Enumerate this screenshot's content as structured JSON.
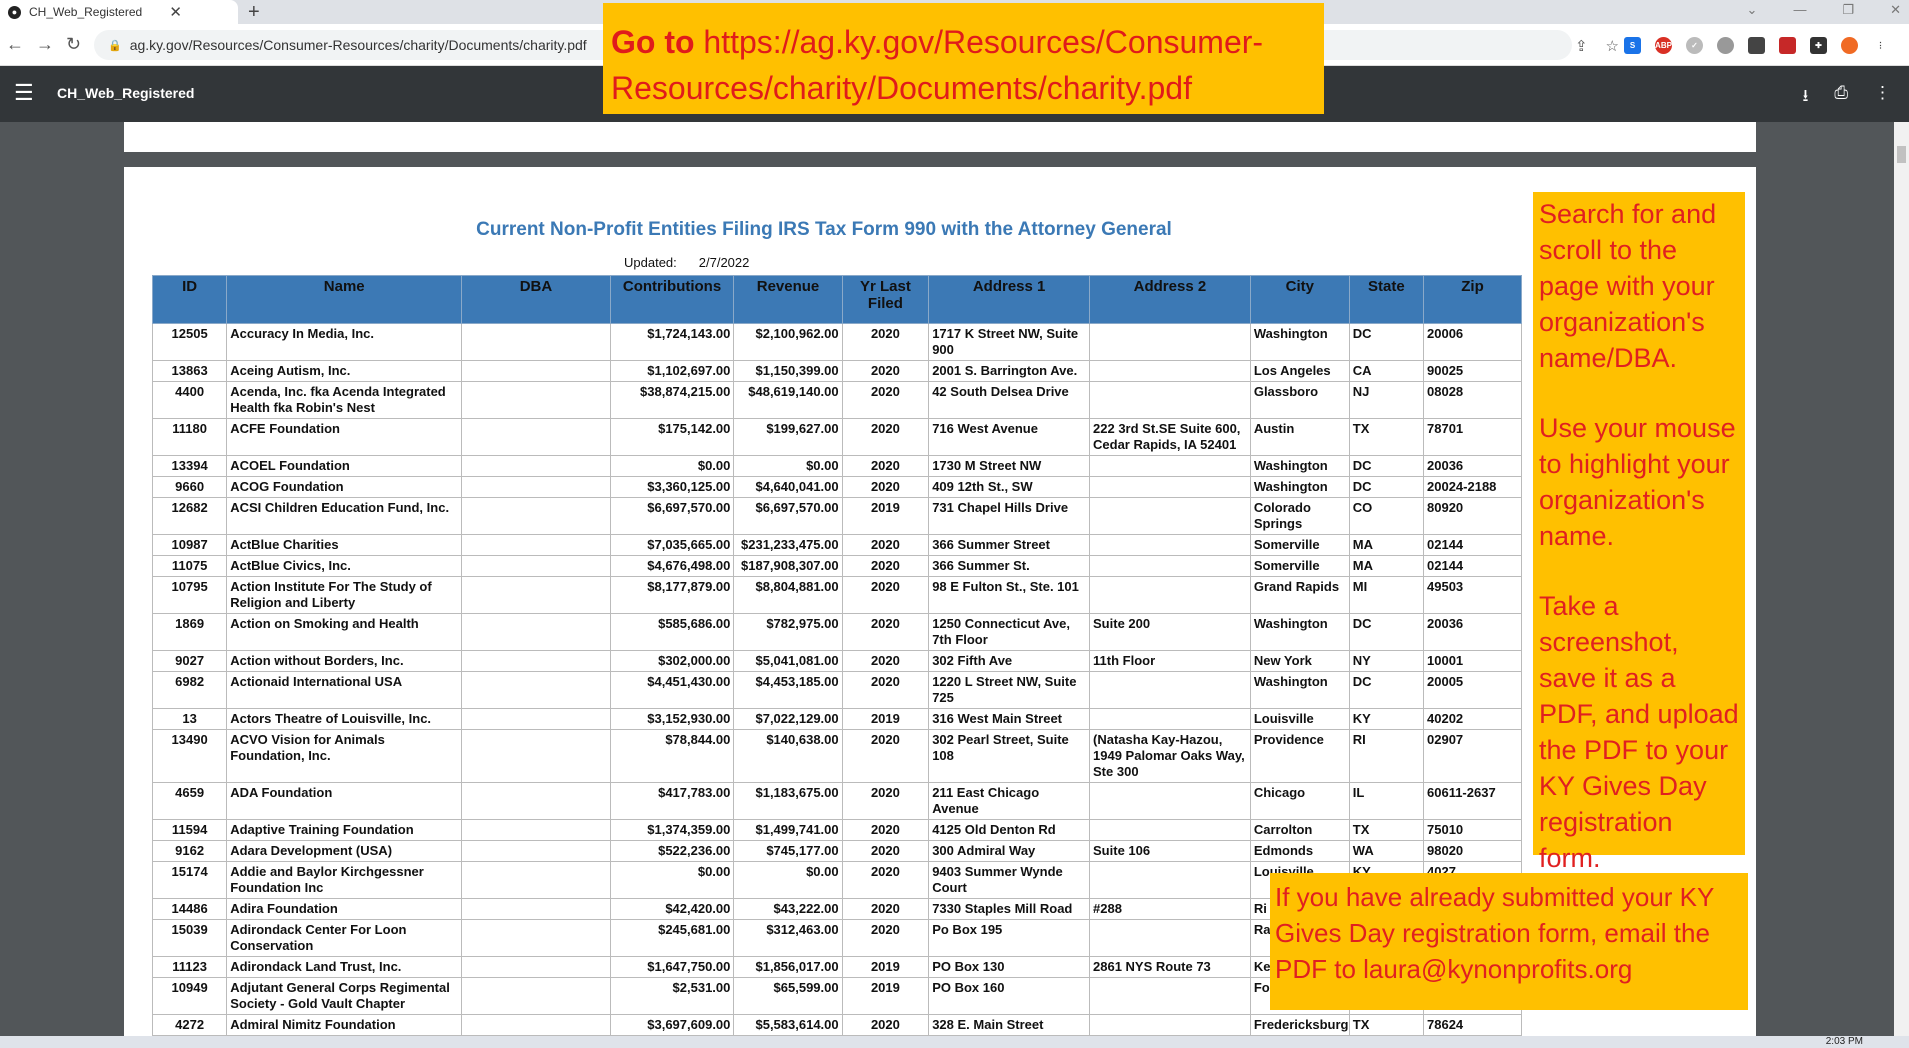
{
  "browser": {
    "tab_title": "CH_Web_Registered",
    "url": "ag.ky.gov/Resources/Consumer-Resources/charity/Documents/charity.pdf"
  },
  "pdf_viewer": {
    "title": "CH_Web_Registered"
  },
  "document": {
    "title": "Current Non-Profit Entities Filing IRS Tax Form 990 with the Attorney General",
    "updated_label": "Updated:",
    "updated_date": "2/7/2022",
    "columns": [
      "ID",
      "Name",
      "DBA",
      "Contributions",
      "Revenue",
      "Yr Last Filed",
      "Address 1",
      "Address 2",
      "City",
      "State",
      "Zip"
    ],
    "rows": [
      [
        "12505",
        "Accuracy In Media, Inc.",
        "",
        "$1,724,143.00",
        "$2,100,962.00",
        "2020",
        "1717 K Street NW, Suite 900",
        "",
        "Washington",
        "DC",
        "20006"
      ],
      [
        "13863",
        "Aceing Autism, Inc.",
        "",
        "$1,102,697.00",
        "$1,150,399.00",
        "2020",
        "2001 S. Barrington Ave.",
        "",
        "Los Angeles",
        "CA",
        "90025"
      ],
      [
        "4400",
        "Acenda, Inc. fka Acenda Integrated Health fka Robin's Nest",
        "",
        "$38,874,215.00",
        "$48,619,140.00",
        "2020",
        "42 South Delsea Drive",
        "",
        "Glassboro",
        "NJ",
        "08028"
      ],
      [
        "11180",
        "ACFE Foundation",
        "",
        "$175,142.00",
        "$199,627.00",
        "2020",
        "716 West Avenue",
        "222 3rd St.SE Suite 600, Cedar Rapids, IA 52401",
        "Austin",
        "TX",
        "78701"
      ],
      [
        "13394",
        "ACOEL Foundation",
        "",
        "$0.00",
        "$0.00",
        "2020",
        "1730 M Street NW",
        "",
        "Washington",
        "DC",
        "20036"
      ],
      [
        "9660",
        "ACOG Foundation",
        "",
        "$3,360,125.00",
        "$4,640,041.00",
        "2020",
        "409 12th St., SW",
        "",
        "Washington",
        "DC",
        "20024-2188"
      ],
      [
        "12682",
        "ACSI Children Education Fund, Inc.",
        "",
        "$6,697,570.00",
        "$6,697,570.00",
        "2019",
        "731 Chapel Hills Drive",
        "",
        "Colorado Springs",
        "CO",
        "80920"
      ],
      [
        "10987",
        "ActBlue Charities",
        "",
        "$7,035,665.00",
        "$231,233,475.00",
        "2020",
        "366 Summer Street",
        "",
        "Somerville",
        "MA",
        "02144"
      ],
      [
        "11075",
        "ActBlue Civics, Inc.",
        "",
        "$4,676,498.00",
        "$187,908,307.00",
        "2020",
        "366 Summer St.",
        "",
        "Somerville",
        "MA",
        "02144"
      ],
      [
        "10795",
        "Action Institute For The Study of Religion and Liberty",
        "",
        "$8,177,879.00",
        "$8,804,881.00",
        "2020",
        "98 E Fulton St., Ste. 101",
        "",
        "Grand Rapids",
        "MI",
        "49503"
      ],
      [
        "1869",
        "Action on Smoking and Health",
        "",
        "$585,686.00",
        "$782,975.00",
        "2020",
        "1250 Connecticut Ave, 7th Floor",
        "Suite 200",
        "Washington",
        "DC",
        "20036"
      ],
      [
        "9027",
        "Action without Borders, Inc.",
        "",
        "$302,000.00",
        "$5,041,081.00",
        "2020",
        "302 Fifth Ave",
        "11th Floor",
        "New York",
        "NY",
        "10001"
      ],
      [
        "6982",
        "Actionaid International USA",
        "",
        "$4,451,430.00",
        "$4,453,185.00",
        "2020",
        "1220 L Street NW, Suite 725",
        "",
        "Washington",
        "DC",
        "20005"
      ],
      [
        "13",
        "Actors Theatre of Louisville, Inc.",
        "",
        "$3,152,930.00",
        "$7,022,129.00",
        "2019",
        "316 West Main Street",
        "",
        "Louisville",
        "KY",
        "40202"
      ],
      [
        "13490",
        "ACVO Vision for Animals Foundation, Inc.",
        "",
        "$78,844.00",
        "$140,638.00",
        "2020",
        "302 Pearl Street, Suite 108",
        "(Natasha Kay-Hazou, 1949 Palomar Oaks Way, Ste 300",
        "Providence",
        "RI",
        "02907"
      ],
      [
        "4659",
        "ADA Foundation",
        "",
        "$417,783.00",
        "$1,183,675.00",
        "2020",
        "211 East Chicago Avenue",
        "",
        "Chicago",
        "IL",
        "60611-2637"
      ],
      [
        "11594",
        "Adaptive Training Foundation",
        "",
        "$1,374,359.00",
        "$1,499,741.00",
        "2020",
        "4125 Old Denton Rd",
        "",
        "Carrolton",
        "TX",
        "75010"
      ],
      [
        "9162",
        "Adara Development (USA)",
        "",
        "$522,236.00",
        "$745,177.00",
        "2020",
        "300 Admiral Way",
        "Suite 106",
        "Edmonds",
        "WA",
        "98020"
      ],
      [
        "15174",
        "Addie and Baylor Kirchgessner Foundation Inc",
        "",
        "$0.00",
        "$0.00",
        "2020",
        "9403 Summer Wynde Court",
        "",
        "Louisville",
        "KY",
        "4027"
      ],
      [
        "14486",
        "Adira Foundation",
        "",
        "$42,420.00",
        "$43,222.00",
        "2020",
        "7330 Staples Mill Road",
        "#288",
        "Ri",
        "",
        ""
      ],
      [
        "15039",
        "Adirondack Center For Loon Conservation",
        "",
        "$245,681.00",
        "$312,463.00",
        "2020",
        "Po Box 195",
        "",
        "Ra",
        "",
        ""
      ],
      [
        "11123",
        "Adirondack Land Trust, Inc.",
        "",
        "$1,647,750.00",
        "$1,856,017.00",
        "2019",
        "PO Box 130",
        "2861 NYS Route 73",
        "Ke",
        "",
        ""
      ],
      [
        "10949",
        "Adjutant General Corps Regimental Society - Gold Vault Chapter",
        "",
        "$2,531.00",
        "$65,599.00",
        "2019",
        "PO Box 160",
        "",
        "Fo",
        "",
        ""
      ],
      [
        "4272",
        "Admiral Nimitz Foundation",
        "",
        "$3,697,609.00",
        "$5,583,614.00",
        "2020",
        "328 E. Main Street",
        "",
        "Fredericksburg",
        "TX",
        "78624"
      ]
    ]
  },
  "callouts": {
    "top_prefix": "Go to",
    "top_url": "https://ag.ky.gov/Resources/Consumer-Resources/charity/Documents/charity.pdf",
    "right_p1": "Search for and scroll to the page with your organization's name/DBA.",
    "right_p2": "Use your mouse to highlight your organization's name.",
    "right_p3": "Take a screenshot, save it as a PDF, and upload the PDF to your KY Gives Day registration form.",
    "bottom": "If you have already submitted your KY Gives Day registration form, email the PDF to laura@kynonprofits.org"
  },
  "taskbar": {
    "clock": "2:03 PM"
  },
  "colors": {
    "header_blue": "#3c79b5",
    "title_blue": "#3b79b5",
    "callout_bg": "#ffc000",
    "callout_text": "#e02020"
  }
}
